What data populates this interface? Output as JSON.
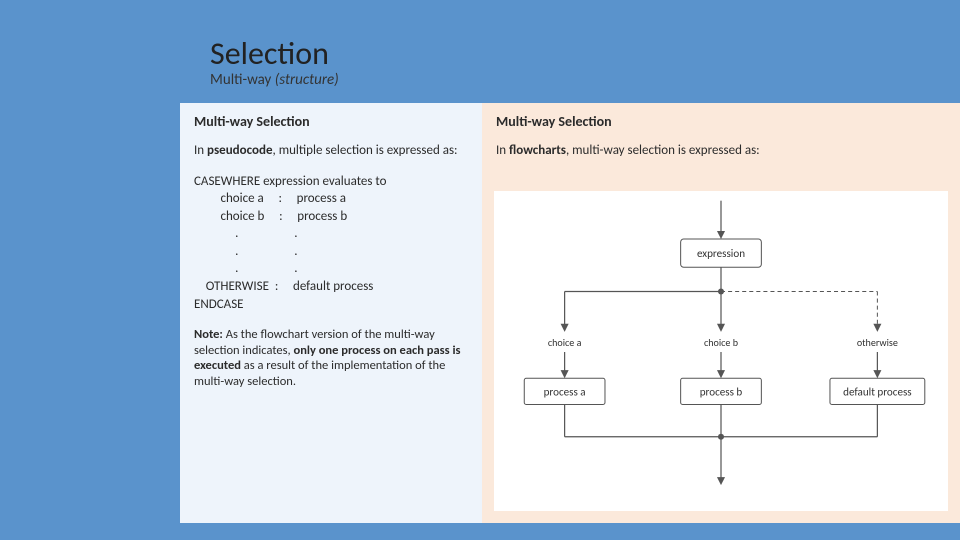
{
  "header": {
    "title": "Selection",
    "subtitle_plain": "Multi-way ",
    "subtitle_ital": "(structure)"
  },
  "left": {
    "heading": "Multi-way Selection",
    "lead_prefix": "In ",
    "lead_bold": "pseudocode",
    "lead_suffix": ", multiple selection is expressed as:",
    "pseudo_line1": "CASEWHERE expression evaluates to",
    "pseudo_l2a": "choice a",
    "pseudo_l2b": ":",
    "pseudo_l2c": "process a",
    "pseudo_l3a": "choice b",
    "pseudo_l3b": ":",
    "pseudo_l3c": "process b",
    "pseudo_dot": ".",
    "pseudo_l5a": "OTHERWISE",
    "pseudo_l5b": ":",
    "pseudo_l5c": "default process",
    "pseudo_end": "ENDCASE",
    "note_bold1": "Note:",
    "note_t1": " As the flowchart version of the multi-way selection indicates, ",
    "note_bold2": "only one process on each pass is executed",
    "note_t2": " as a result of the implementation of the",
    "note_t3": "multi-way selection."
  },
  "right": {
    "heading": "Multi-way Selection",
    "lead_prefix": "In ",
    "lead_bold": "flowcharts",
    "lead_suffix": ", multi-way selection is expressed as:",
    "fc": {
      "expression": "expression",
      "choice_a": "choice a",
      "choice_b": "choice b",
      "otherwise": "otherwise",
      "process_a": "process a",
      "process_b": "process b",
      "default_process": "default process"
    }
  },
  "chart_data": {
    "type": "table",
    "title": "Multi-way selection flowchart",
    "decision_node": "expression",
    "branches": [
      {
        "label": "choice a",
        "process": "process a"
      },
      {
        "label": "choice b",
        "process": "process b"
      },
      {
        "label": "otherwise",
        "process": "default process"
      }
    ],
    "merge_after_processes": true,
    "note": "Only one process executes per pass."
  }
}
